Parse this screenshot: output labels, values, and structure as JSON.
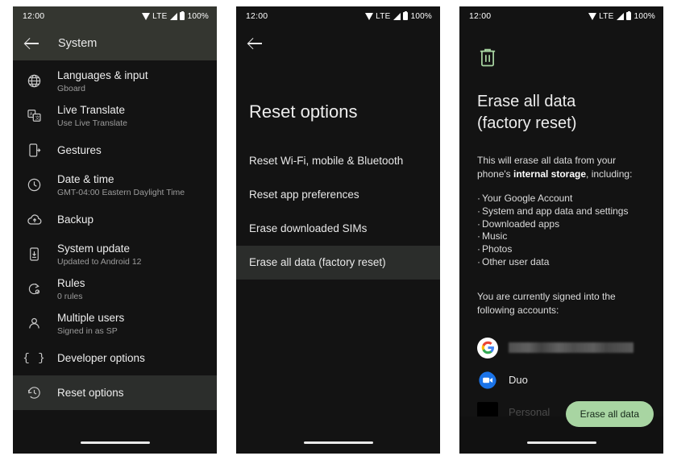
{
  "status_bar": {
    "time": "12:00",
    "network": "LTE",
    "battery": "100%",
    "icons": [
      "wifi-icon",
      "signal-icon",
      "battery-icon"
    ]
  },
  "colors": {
    "panel_bg": "#131313",
    "appbar_bg": "#343630",
    "selected_row_bg": "#2c2e2c",
    "accent_green": "#a8d5a2",
    "trash_icon_green": "#a8d5a2",
    "text_primary": "#ededed",
    "text_secondary": "#9c9c9c",
    "page_bg": "#ffffff"
  },
  "panel_system": {
    "appbar": {
      "back_icon": "back-arrow-icon",
      "title": "System"
    },
    "items": [
      {
        "title": "Languages & input",
        "subtitle": "Gboard",
        "icon": "globe-icon",
        "selected": false
      },
      {
        "title": "Live Translate",
        "subtitle": "Use Live Translate",
        "icon": "live-translate-icon",
        "selected": false
      },
      {
        "title": "Gestures",
        "subtitle": "",
        "icon": "gestures-icon",
        "selected": false
      },
      {
        "title": "Date & time",
        "subtitle": "GMT-04:00 Eastern Daylight Time",
        "icon": "clock-icon",
        "selected": false
      },
      {
        "title": "Backup",
        "subtitle": "",
        "icon": "cloud-upload-icon",
        "selected": false
      },
      {
        "title": "System update",
        "subtitle": "Updated to Android 12",
        "icon": "system-update-icon",
        "selected": false
      },
      {
        "title": "Rules",
        "subtitle": "0 rules",
        "icon": "rules-icon",
        "selected": false
      },
      {
        "title": "Multiple users",
        "subtitle": "Signed in as SP",
        "icon": "person-icon",
        "selected": false
      },
      {
        "title": "Developer options",
        "subtitle": "",
        "icon": "braces-icon",
        "selected": false
      },
      {
        "title": "Reset options",
        "subtitle": "",
        "icon": "history-icon",
        "selected": true
      }
    ]
  },
  "panel_reset": {
    "appbar": {
      "back_icon": "back-arrow-icon"
    },
    "title": "Reset options",
    "options": [
      {
        "label": "Reset Wi-Fi, mobile & Bluetooth",
        "selected": false
      },
      {
        "label": "Reset app preferences",
        "selected": false
      },
      {
        "label": "Erase downloaded SIMs",
        "selected": false
      },
      {
        "label": "Erase all data (factory reset)",
        "selected": true
      }
    ]
  },
  "panel_erase": {
    "trash_icon": "trash-icon",
    "heading_line1": "Erase all data",
    "heading_line2": "(factory reset)",
    "description_prefix": "This will erase all data from your phone's ",
    "description_bold": "internal storage",
    "description_suffix": ", including:",
    "bullets": [
      "Your Google Account",
      "System and app data and settings",
      "Downloaded apps",
      "Music",
      "Photos",
      "Other user data"
    ],
    "accounts_note": "You are currently signed into the following accounts:",
    "accounts": [
      {
        "label": "",
        "icon": "google-logo-icon",
        "redacted": true
      },
      {
        "label": "Duo",
        "icon": "duo-icon",
        "redacted": false
      },
      {
        "label": "Personal",
        "icon": "blank-avatar-icon",
        "redacted": false
      }
    ],
    "confirm_button": "Erase all data"
  }
}
